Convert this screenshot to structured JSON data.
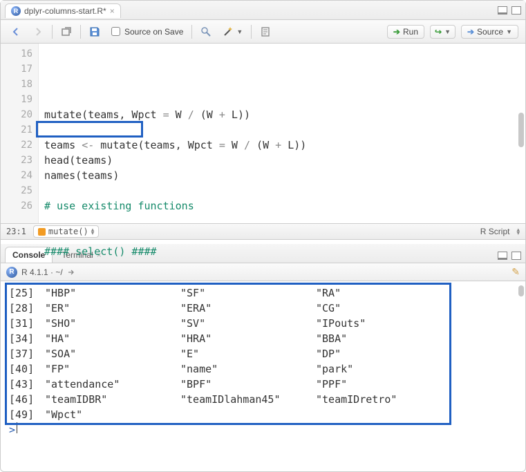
{
  "tab": {
    "title": "dplyr-columns-start.R*"
  },
  "toolbar": {
    "source_on_save": "Source on Save",
    "run": "Run",
    "source": "Source"
  },
  "editor": {
    "lines": [
      {
        "n": 16,
        "html": ""
      },
      {
        "n": 17,
        "html": "mutate(teams, Wpct <span class='op'>=</span> W <span class='op'>/</span> (W <span class='op'>+</span> L))"
      },
      {
        "n": 18,
        "html": ""
      },
      {
        "n": 19,
        "html": "teams <span class='op'>&lt;-</span> mutate(teams, Wpct <span class='op'>=</span> W <span class='op'>/</span> (W <span class='op'>+</span> L))"
      },
      {
        "n": 20,
        "html": "head(teams)"
      },
      {
        "n": 21,
        "html": "names(teams)"
      },
      {
        "n": 22,
        "html": ""
      },
      {
        "n": 23,
        "html": "<span class='cmt'># use existing functions</span>"
      },
      {
        "n": 24,
        "html": ""
      },
      {
        "n": 25,
        "html": ""
      },
      {
        "n": 26,
        "html": "<span class='cmt'>#### select() ####</span>"
      }
    ]
  },
  "status": {
    "pos": "23:1",
    "scope": "mutate()",
    "lang": "R Script"
  },
  "bottom_tabs": {
    "console": "Console",
    "terminal": "Terminal"
  },
  "console": {
    "session": "R 4.1.1 · ~/",
    "rows": [
      {
        "idx": "[25]",
        "cols": [
          "\"HBP\"",
          "\"SF\"",
          "\"RA\""
        ]
      },
      {
        "idx": "[28]",
        "cols": [
          "\"ER\"",
          "\"ERA\"",
          "\"CG\""
        ]
      },
      {
        "idx": "[31]",
        "cols": [
          "\"SHO\"",
          "\"SV\"",
          "\"IPouts\""
        ]
      },
      {
        "idx": "[34]",
        "cols": [
          "\"HA\"",
          "\"HRA\"",
          "\"BBA\""
        ]
      },
      {
        "idx": "[37]",
        "cols": [
          "\"SOA\"",
          "\"E\"",
          "\"DP\""
        ]
      },
      {
        "idx": "[40]",
        "cols": [
          "\"FP\"",
          "\"name\"",
          "\"park\""
        ]
      },
      {
        "idx": "[43]",
        "cols": [
          "\"attendance\"",
          "\"BPF\"",
          "\"PPF\""
        ]
      },
      {
        "idx": "[46]",
        "cols": [
          "\"teamIDBR\"",
          "\"teamIDlahman45\"",
          "\"teamIDretro\""
        ]
      },
      {
        "idx": "[49]",
        "cols": [
          "\"Wpct\"",
          "",
          ""
        ]
      }
    ],
    "prompt": ">"
  }
}
